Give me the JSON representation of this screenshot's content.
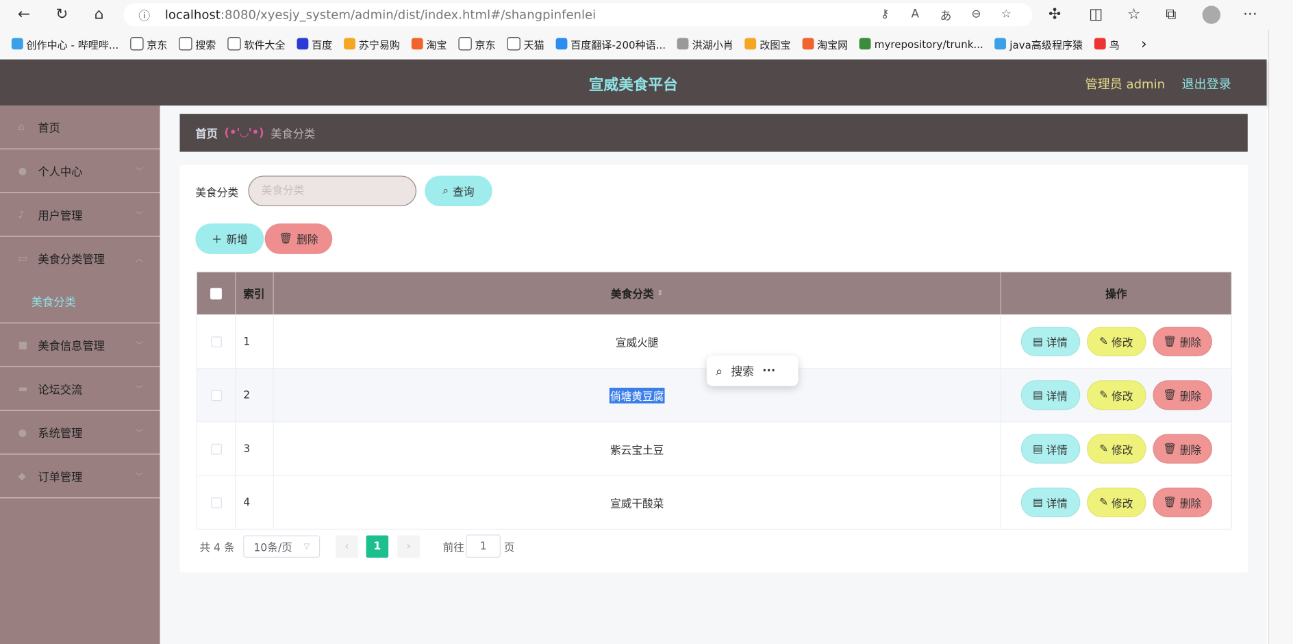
{
  "browser": {
    "url_host": "localhost",
    "url_rest": ":8080/xyesjy_system/admin/dist/index.html#/shangpinfenlei",
    "bookmarks": [
      "创作中心 - 哔哩哔...",
      "京东",
      "搜索",
      "软件大全",
      "百度",
      "苏宁易购",
      "淘宝",
      "京东",
      "天猫",
      "百度翻译-200种语...",
      "洪湖小肖",
      "改图宝",
      "淘宝网",
      "myrepository/trunk...",
      "java高级程序猿",
      "鸟"
    ]
  },
  "header": {
    "title": "宣威美食平台",
    "user": "管理员 admin",
    "logout": "退出登录"
  },
  "sidebar": {
    "items": [
      {
        "label": "首页",
        "icon": "home-icon"
      },
      {
        "label": "个人中心",
        "icon": "user-icon"
      },
      {
        "label": "用户管理",
        "icon": "mic-icon"
      },
      {
        "label": "美食分类管理",
        "icon": "monitor-icon"
      },
      {
        "label": "美食信息管理",
        "icon": "briefcase-icon"
      },
      {
        "label": "论坛交流",
        "icon": "chat-icon"
      },
      {
        "label": "系统管理",
        "icon": "user-icon"
      },
      {
        "label": "订单管理",
        "icon": "shield-icon"
      }
    ],
    "sub_active": "美食分类"
  },
  "breadcrumb": {
    "home": "首页",
    "separator": "(•'◡'•)",
    "current": "美食分类"
  },
  "search": {
    "label": "美食分类",
    "placeholder": "美食分类",
    "button": "查询"
  },
  "actions": {
    "add": "新增",
    "delete": "删除"
  },
  "table": {
    "headers": {
      "index": "索引",
      "name": "美食分类",
      "ops": "操作"
    },
    "rows": [
      {
        "index": "1",
        "name": "宣威火腿"
      },
      {
        "index": "2",
        "name": "倘塘黄豆腐"
      },
      {
        "index": "3",
        "name": "紫云宝土豆"
      },
      {
        "index": "4",
        "name": "宣威干酸菜"
      }
    ],
    "row_buttons": {
      "detail": "详情",
      "edit": "修改",
      "delete": "删除"
    }
  },
  "popup": {
    "search": "搜索",
    "more": "···"
  },
  "pagination": {
    "total": "共 4 条",
    "page_size": "10条/页",
    "current_page": "1",
    "goto_label": "前往",
    "goto_value": "1",
    "page_suffix": "页",
    "accent": "#1cbf8e"
  },
  "colors": {
    "header": "#524a4a",
    "sidebar": "#997f80",
    "accent_cyan": "#8fe3e6"
  }
}
